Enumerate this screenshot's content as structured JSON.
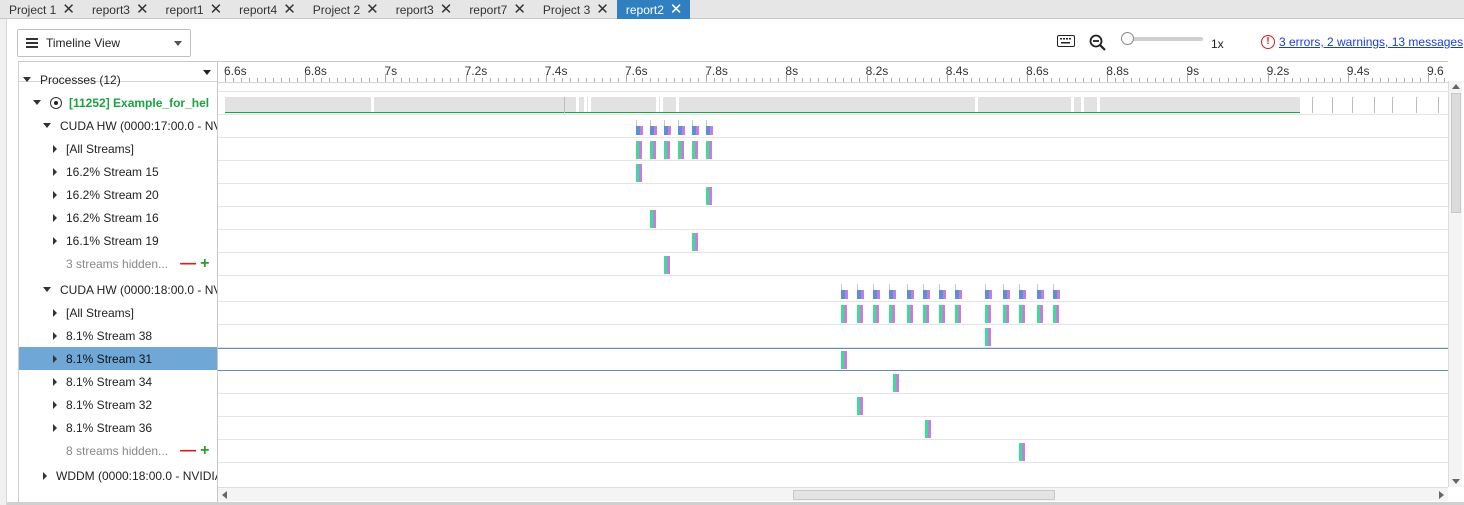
{
  "tabs": [
    {
      "label": "Project 1",
      "active": false
    },
    {
      "label": "report3",
      "active": false
    },
    {
      "label": "report1",
      "active": false
    },
    {
      "label": "report4",
      "active": false
    },
    {
      "label": "Project 2",
      "active": false
    },
    {
      "label": "report3",
      "active": false
    },
    {
      "label": "report7",
      "active": false
    },
    {
      "label": "Project 3",
      "active": false
    },
    {
      "label": "report2",
      "active": true
    }
  ],
  "toolbar": {
    "view_label": "Timeline View",
    "zoom_level": "1x",
    "diagnostics_link": "3 errors, 2 warnings, 13 messages",
    "icons": [
      "keyboard-icon",
      "zoom-out-icon",
      "error-icon",
      "hamburger-icon"
    ]
  },
  "ruler": {
    "unit": "s",
    "ticks": [
      "6.6s",
      "6.8s",
      "7s",
      "7.2s",
      "7.4s",
      "7.6s",
      "7.8s",
      "8s",
      "8.2s",
      "8.4s",
      "8.6s",
      "8.8s",
      "9s",
      "9.2s",
      "9.4s",
      "9.6"
    ]
  },
  "tree": [
    {
      "label": "Processes (12)",
      "level": 0,
      "expander": "down",
      "kind": "group"
    },
    {
      "label": "[11252] Example_for_hel",
      "level": 1,
      "expander": "down",
      "kind": "process"
    },
    {
      "label": "CUDA HW (0000:17:00.0 - NV",
      "level": 2,
      "expander": "down",
      "kind": "device"
    },
    {
      "label": "[All Streams]",
      "level": 3,
      "expander": "right",
      "kind": "stream"
    },
    {
      "label": "16.2% Stream 15",
      "level": 3,
      "expander": "right",
      "kind": "stream"
    },
    {
      "label": "16.2% Stream 20",
      "level": 3,
      "expander": "right",
      "kind": "stream"
    },
    {
      "label": "16.2% Stream 16",
      "level": 3,
      "expander": "right",
      "kind": "stream"
    },
    {
      "label": "16.1% Stream 19",
      "level": 3,
      "expander": "right",
      "kind": "stream"
    },
    {
      "label": "3 streams hidden...",
      "level": 3,
      "expander": "none",
      "kind": "hidden"
    },
    {
      "label": "CUDA HW (0000:18:00.0 - NV",
      "level": 2,
      "expander": "down",
      "kind": "device"
    },
    {
      "label": "[All Streams]",
      "level": 3,
      "expander": "right",
      "kind": "stream"
    },
    {
      "label": "8.1% Stream 38",
      "level": 3,
      "expander": "right",
      "kind": "stream"
    },
    {
      "label": "8.1% Stream 31",
      "level": 3,
      "expander": "right",
      "kind": "stream",
      "selected": true
    },
    {
      "label": "8.1% Stream 34",
      "level": 3,
      "expander": "right",
      "kind": "stream"
    },
    {
      "label": "8.1% Stream 32",
      "level": 3,
      "expander": "right",
      "kind": "stream"
    },
    {
      "label": "8.1% Stream 36",
      "level": 3,
      "expander": "right",
      "kind": "stream"
    },
    {
      "label": "8 streams hidden...",
      "level": 3,
      "expander": "none",
      "kind": "hidden"
    },
    {
      "label": "WDDM (0000:18:00.0 - NVIDIA",
      "level": 2,
      "expander": "right",
      "kind": "device"
    }
  ],
  "colors": {
    "kernel_green": "#3ddc97",
    "kernel_purple": "#c77ddb",
    "kernel_blue": "#5b8fd6",
    "process_bar": "#e2e2e2",
    "process_line": "#1aa340",
    "selection": "#6fa7d6",
    "error_red": "#d02020",
    "link_blue": "#1a3fd0"
  },
  "timeline": {
    "process_gaps_s": [
      6.963,
      7.475,
      7.495,
      7.505,
      7.675,
      7.685,
      7.725,
      8.47,
      8.71,
      8.735,
      8.775,
      9.28
    ],
    "process_ticks_s": [
      7.445,
      9.31,
      9.36,
      9.41,
      9.465,
      9.51,
      9.57,
      9.625
    ],
    "device1_kernels_s": [
      7.625,
      7.66,
      7.695,
      7.73,
      7.765,
      7.8
    ],
    "device2_kernels_s": [
      8.135,
      8.175,
      8.215,
      8.255,
      8.3,
      8.34,
      8.38,
      8.42,
      8.495,
      8.54,
      8.58,
      8.625,
      8.665
    ],
    "stream_kernels": [
      {
        "row": 4,
        "t": 7.625
      },
      {
        "row": 5,
        "t": 7.8
      },
      {
        "row": 6,
        "t": 7.66
      },
      {
        "row": 7,
        "t": 7.765
      },
      {
        "row": 8,
        "t": 7.695
      },
      {
        "row": 11,
        "t": 8.495
      },
      {
        "row": 12,
        "t": 8.135
      },
      {
        "row": 13,
        "t": 8.265
      },
      {
        "row": 14,
        "t": 8.175
      },
      {
        "row": 15,
        "t": 8.345
      },
      {
        "row": 16,
        "t": 8.58
      }
    ]
  }
}
